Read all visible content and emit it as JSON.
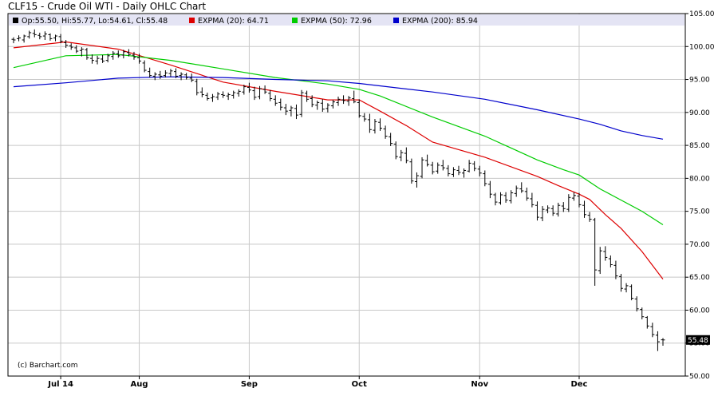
{
  "page": {
    "title": "CLF15 - Crude Oil WTI - Daily OHLC Chart"
  },
  "chart_data": {
    "type": "ohlc",
    "title": "CLF15 - Crude Oil WTI - Daily OHLC Chart",
    "credit": "(c) Barchart.com",
    "ylim": [
      50,
      105
    ],
    "yticks": [
      "105.00",
      "100.00",
      "95.00",
      "90.00",
      "85.00",
      "80.00",
      "75.00",
      "70.00",
      "65.00",
      "60.00",
      "55.00",
      "50.00"
    ],
    "xticks": [
      {
        "label": "Jul 14",
        "index": 9
      },
      {
        "label": "Aug",
        "index": 24
      },
      {
        "label": "Sep",
        "index": 45
      },
      {
        "label": "Oct",
        "index": 66
      },
      {
        "label": "Nov",
        "index": 89
      },
      {
        "label": "Dec",
        "index": 108
      }
    ],
    "n_slots": 125,
    "grid": true,
    "legend_position": "top",
    "colors": {
      "bars": "#000000",
      "ema20": "#dd0000",
      "ema50": "#00cc00",
      "ema200": "#0000cc",
      "legend_band": "#e4e4f4",
      "grid": "#c8c8c8",
      "last_label_bg": "#000000"
    },
    "legend": [
      {
        "text": "Op:55.50, Hi:55.77, Lo:54.61, Cl:55.48",
        "color": "#000000"
      },
      {
        "text": "EXPMA (20): 64.71",
        "color": "#dd0000"
      },
      {
        "text": "EXPMA (50): 72.96",
        "color": "#00cc00"
      },
      {
        "text": "EXPMA (200): 85.94",
        "color": "#0000cc"
      }
    ],
    "last_label": "55.48",
    "last_value": 55.48,
    "bars": [
      [
        0,
        101.1,
        101.4,
        100.5,
        101.0
      ],
      [
        1,
        101.2,
        101.7,
        100.8,
        101.3
      ],
      [
        2,
        101.0,
        101.8,
        100.6,
        101.6
      ],
      [
        3,
        101.5,
        102.4,
        101.2,
        102.1
      ],
      [
        4,
        102.0,
        102.6,
        101.4,
        101.8
      ],
      [
        5,
        101.7,
        102.1,
        101.1,
        101.5
      ],
      [
        6,
        101.6,
        102.3,
        101.0,
        101.9
      ],
      [
        7,
        101.8,
        102.0,
        100.9,
        101.2
      ],
      [
        8,
        101.3,
        101.8,
        100.8,
        101.6
      ],
      [
        9,
        101.5,
        101.9,
        100.5,
        100.8
      ],
      [
        10,
        100.6,
        101.0,
        99.8,
        100.2
      ],
      [
        11,
        100.1,
        100.5,
        99.5,
        99.9
      ],
      [
        12,
        99.8,
        100.2,
        99.0,
        99.3
      ],
      [
        13,
        99.4,
        99.9,
        98.5,
        99.6
      ],
      [
        14,
        99.5,
        99.8,
        98.0,
        98.3
      ],
      [
        15,
        98.2,
        98.8,
        97.4,
        97.9
      ],
      [
        16,
        97.8,
        98.6,
        97.3,
        98.2
      ],
      [
        17,
        98.1,
        98.7,
        97.5,
        97.8
      ],
      [
        18,
        97.9,
        98.9,
        97.6,
        98.6
      ],
      [
        19,
        98.5,
        99.3,
        98.0,
        99.0
      ],
      [
        20,
        98.9,
        99.4,
        98.3,
        98.6
      ],
      [
        21,
        98.7,
        99.5,
        98.2,
        99.2
      ],
      [
        22,
        99.1,
        99.6,
        98.5,
        98.8
      ],
      [
        23,
        98.7,
        99.2,
        98.0,
        98.4
      ],
      [
        24,
        98.3,
        98.9,
        97.4,
        97.8
      ],
      [
        25,
        97.5,
        97.9,
        96.1,
        96.4
      ],
      [
        26,
        96.2,
        96.8,
        95.3,
        95.6
      ],
      [
        27,
        95.5,
        96.1,
        94.9,
        95.8
      ],
      [
        28,
        95.7,
        96.3,
        95.1,
        95.5
      ],
      [
        29,
        95.6,
        96.4,
        95.3,
        96.0
      ],
      [
        30,
        95.9,
        96.6,
        95.4,
        96.3
      ],
      [
        31,
        96.2,
        96.7,
        95.2,
        95.5
      ],
      [
        32,
        95.6,
        96.1,
        94.9,
        95.8
      ],
      [
        33,
        95.7,
        96.0,
        95.0,
        95.3
      ],
      [
        34,
        95.2,
        95.9,
        94.6,
        94.9
      ],
      [
        35,
        94.7,
        95.1,
        92.6,
        93.0
      ],
      [
        36,
        93.1,
        93.8,
        92.3,
        92.7
      ],
      [
        37,
        92.6,
        93.0,
        91.8,
        92.1
      ],
      [
        38,
        92.2,
        92.8,
        91.6,
        92.4
      ],
      [
        39,
        92.3,
        93.1,
        91.9,
        92.8
      ],
      [
        40,
        92.7,
        93.2,
        92.2,
        92.6
      ],
      [
        41,
        92.5,
        93.0,
        91.9,
        92.7
      ],
      [
        42,
        92.6,
        93.3,
        92.1,
        93.0
      ],
      [
        43,
        92.9,
        93.5,
        92.4,
        93.2
      ],
      [
        44,
        93.1,
        94.2,
        92.7,
        93.9
      ],
      [
        45,
        93.8,
        94.5,
        93.0,
        93.4
      ],
      [
        46,
        93.3,
        93.9,
        91.9,
        92.3
      ],
      [
        47,
        92.4,
        94.0,
        92.0,
        93.6
      ],
      [
        48,
        93.5,
        94.1,
        92.8,
        93.1
      ],
      [
        49,
        92.9,
        93.4,
        91.7,
        92.1
      ],
      [
        50,
        92.0,
        92.6,
        91.0,
        91.4
      ],
      [
        51,
        91.5,
        92.1,
        90.3,
        90.8
      ],
      [
        52,
        90.7,
        91.3,
        89.6,
        90.2
      ],
      [
        53,
        90.3,
        91.0,
        89.4,
        90.7
      ],
      [
        54,
        90.6,
        91.2,
        89.0,
        89.6
      ],
      [
        55,
        89.7,
        93.4,
        89.3,
        93.0
      ],
      [
        56,
        92.9,
        93.3,
        91.6,
        92.0
      ],
      [
        57,
        92.1,
        92.6,
        90.8,
        91.2
      ],
      [
        58,
        91.1,
        91.8,
        90.4,
        91.5
      ],
      [
        59,
        91.4,
        92.0,
        90.1,
        90.5
      ],
      [
        60,
        90.6,
        91.4,
        90.0,
        91.1
      ],
      [
        61,
        91.0,
        91.9,
        90.6,
        91.6
      ],
      [
        62,
        91.5,
        92.4,
        91.0,
        92.0
      ],
      [
        63,
        91.9,
        92.6,
        91.3,
        91.8
      ],
      [
        64,
        91.7,
        92.5,
        91.0,
        92.2
      ],
      [
        65,
        92.1,
        93.3,
        91.4,
        91.6
      ],
      [
        66,
        91.5,
        92.0,
        89.2,
        89.5
      ],
      [
        67,
        89.4,
        89.9,
        88.6,
        89.0
      ],
      [
        68,
        88.9,
        89.8,
        86.9,
        87.4
      ],
      [
        69,
        87.3,
        89.0,
        86.8,
        88.6
      ],
      [
        70,
        88.5,
        89.1,
        87.2,
        87.6
      ],
      [
        71,
        87.5,
        88.0,
        86.0,
        86.4
      ],
      [
        72,
        86.3,
        86.9,
        84.9,
        85.3
      ],
      [
        73,
        85.2,
        85.6,
        82.9,
        83.3
      ],
      [
        74,
        83.2,
        84.3,
        82.6,
        83.9
      ],
      [
        75,
        83.8,
        84.7,
        82.3,
        82.7
      ],
      [
        76,
        82.5,
        83.0,
        79.2,
        79.6
      ],
      [
        77,
        79.5,
        80.9,
        78.6,
        80.4
      ],
      [
        78,
        80.3,
        83.2,
        80.0,
        82.8
      ],
      [
        79,
        82.7,
        83.6,
        81.8,
        82.1
      ],
      [
        80,
        82.0,
        82.5,
        80.6,
        81.0
      ],
      [
        81,
        81.1,
        82.4,
        80.7,
        82.0
      ],
      [
        82,
        81.9,
        82.8,
        81.2,
        81.6
      ],
      [
        83,
        81.5,
        82.0,
        80.3,
        80.7
      ],
      [
        84,
        80.6,
        81.7,
        80.2,
        81.3
      ],
      [
        85,
        81.2,
        81.9,
        80.5,
        80.9
      ],
      [
        86,
        80.8,
        81.5,
        80.1,
        81.2
      ],
      [
        87,
        81.1,
        82.8,
        80.9,
        82.3
      ],
      [
        88,
        82.2,
        82.6,
        81.1,
        81.5
      ],
      [
        89,
        81.4,
        81.9,
        80.3,
        80.8
      ],
      [
        90,
        80.7,
        81.2,
        78.8,
        79.2
      ],
      [
        91,
        79.1,
        79.6,
        77.0,
        77.6
      ],
      [
        92,
        77.5,
        77.8,
        75.9,
        76.4
      ],
      [
        93,
        76.3,
        77.9,
        76.0,
        77.5
      ],
      [
        94,
        77.4,
        77.9,
        76.3,
        76.7
      ],
      [
        95,
        76.6,
        78.2,
        76.2,
        77.8
      ],
      [
        96,
        77.7,
        78.9,
        77.2,
        78.5
      ],
      [
        97,
        78.4,
        79.4,
        77.8,
        78.1
      ],
      [
        98,
        78.0,
        78.6,
        76.6,
        77.0
      ],
      [
        99,
        76.9,
        77.8,
        75.6,
        76.0
      ],
      [
        100,
        75.9,
        76.5,
        73.6,
        74.1
      ],
      [
        101,
        74.0,
        75.8,
        73.5,
        75.3
      ],
      [
        102,
        75.2,
        75.9,
        74.7,
        75.5
      ],
      [
        103,
        75.4,
        75.9,
        74.3,
        74.7
      ],
      [
        104,
        74.6,
        76.3,
        74.2,
        75.9
      ],
      [
        105,
        75.8,
        76.4,
        74.9,
        75.4
      ],
      [
        106,
        75.3,
        77.6,
        74.9,
        77.1
      ],
      [
        107,
        77.0,
        77.9,
        76.6,
        77.4
      ],
      [
        108,
        77.3,
        77.8,
        75.6,
        76.0
      ],
      [
        109,
        75.9,
        76.6,
        74.0,
        74.5
      ],
      [
        110,
        74.4,
        74.9,
        73.4,
        73.8
      ],
      [
        111,
        73.7,
        74.0,
        63.7,
        66.1
      ],
      [
        112,
        66.0,
        69.6,
        65.5,
        69.0
      ],
      [
        113,
        68.9,
        69.7,
        67.5,
        68.0
      ],
      [
        114,
        67.8,
        68.3,
        66.5,
        66.9
      ],
      [
        115,
        66.8,
        67.5,
        64.7,
        65.2
      ],
      [
        116,
        65.1,
        65.5,
        62.8,
        63.3
      ],
      [
        117,
        63.2,
        64.1,
        62.7,
        63.7
      ],
      [
        118,
        63.6,
        63.9,
        61.5,
        61.8
      ],
      [
        119,
        61.7,
        62.1,
        59.8,
        60.2
      ],
      [
        120,
        60.1,
        60.4,
        58.6,
        59.0
      ],
      [
        121,
        58.9,
        59.1,
        57.2,
        57.6
      ],
      [
        122,
        57.5,
        58.1,
        55.9,
        56.3
      ],
      [
        123,
        56.2,
        56.8,
        53.8,
        55.2
      ],
      [
        124,
        55.5,
        55.77,
        54.61,
        55.48
      ]
    ],
    "series": [
      {
        "name": "EXPMA (20)",
        "color": "#dd0000",
        "points": [
          [
            0,
            99.8
          ],
          [
            10,
            100.7
          ],
          [
            20,
            99.6
          ],
          [
            30,
            97.2
          ],
          [
            40,
            94.6
          ],
          [
            50,
            93.2
          ],
          [
            60,
            91.9
          ],
          [
            66,
            91.9
          ],
          [
            70,
            90.2
          ],
          [
            75,
            88.0
          ],
          [
            80,
            85.5
          ],
          [
            90,
            83.2
          ],
          [
            100,
            80.3
          ],
          [
            104,
            78.9
          ],
          [
            108,
            77.6
          ],
          [
            110,
            76.8
          ],
          [
            113,
            74.5
          ],
          [
            116,
            72.4
          ],
          [
            120,
            68.9
          ],
          [
            124,
            64.71
          ]
        ]
      },
      {
        "name": "EXPMA (50)",
        "color": "#00cc00",
        "points": [
          [
            0,
            96.8
          ],
          [
            10,
            98.6
          ],
          [
            20,
            98.8
          ],
          [
            30,
            97.9
          ],
          [
            40,
            96.6
          ],
          [
            50,
            95.3
          ],
          [
            60,
            94.3
          ],
          [
            66,
            93.5
          ],
          [
            70,
            92.5
          ],
          [
            80,
            89.3
          ],
          [
            90,
            86.4
          ],
          [
            100,
            82.8
          ],
          [
            105,
            81.3
          ],
          [
            108,
            80.5
          ],
          [
            112,
            78.4
          ],
          [
            116,
            76.7
          ],
          [
            120,
            75.0
          ],
          [
            124,
            72.96
          ]
        ]
      },
      {
        "name": "EXPMA (200)",
        "color": "#0000cc",
        "points": [
          [
            0,
            93.9
          ],
          [
            10,
            94.5
          ],
          [
            20,
            95.2
          ],
          [
            30,
            95.4
          ],
          [
            40,
            95.3
          ],
          [
            50,
            95.0
          ],
          [
            60,
            94.8
          ],
          [
            66,
            94.4
          ],
          [
            80,
            93.1
          ],
          [
            90,
            92.0
          ],
          [
            100,
            90.4
          ],
          [
            108,
            89.0
          ],
          [
            112,
            88.2
          ],
          [
            116,
            87.2
          ],
          [
            120,
            86.5
          ],
          [
            124,
            85.94
          ]
        ]
      }
    ]
  }
}
